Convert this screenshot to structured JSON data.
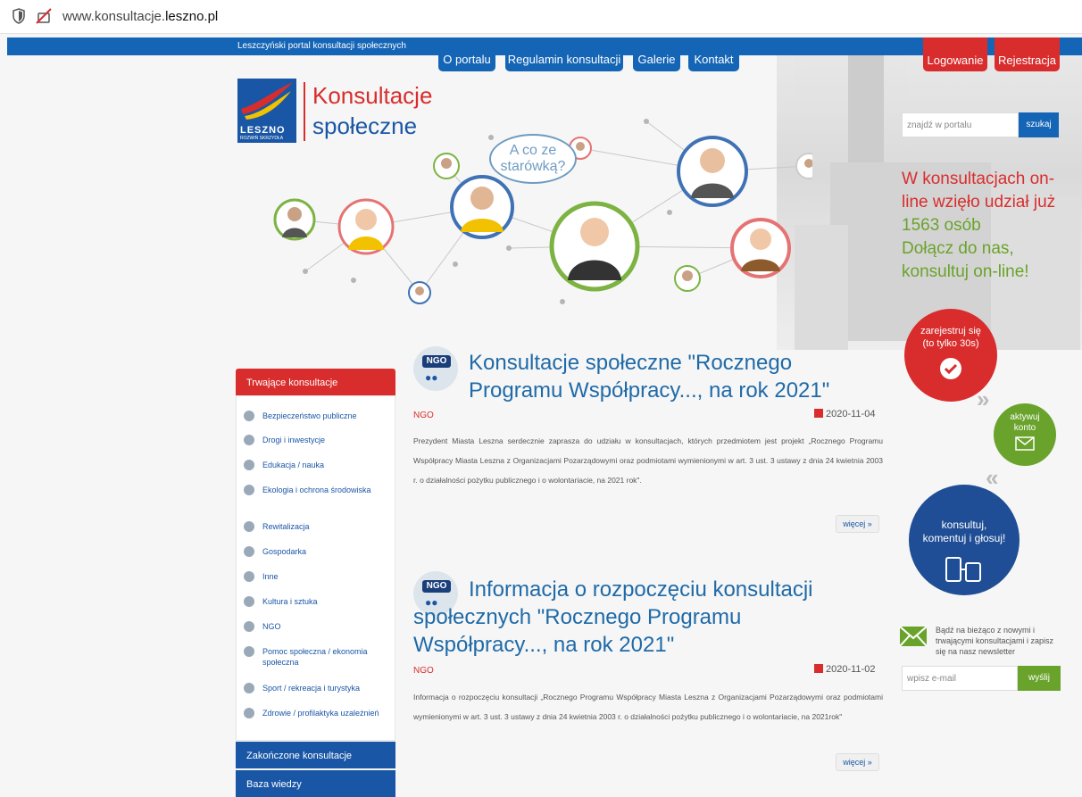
{
  "browser": {
    "url_prefix": "www.konsultacje.",
    "url_domain": "leszno.pl"
  },
  "header": {
    "tagline": "Leszczyński portal konsultacji społecznych",
    "nav": [
      "O portalu",
      "Regulamin konsultacji",
      "Galerie",
      "Kontakt"
    ],
    "login": "Logowanie",
    "register": "Rejestracja"
  },
  "logo": {
    "city": "LESZNO",
    "motto": "ROZWIŃ SKRZYDŁA",
    "brand_line1": "Konsultacje",
    "brand_line2": "społeczne"
  },
  "hero": {
    "bubble_line1": "A co ze",
    "bubble_line2": "starówką?"
  },
  "search": {
    "placeholder": "znajdź w portalu",
    "button": "szukaj"
  },
  "promo": {
    "line1": "W konsultacjach on-line wzięło udział już",
    "count": "1563 osób",
    "line2": "Dołącz do nas, konsultuj on-line!"
  },
  "steps": {
    "step1_line1": "zarejestruj się",
    "step1_line2": "(to tylko 30s)",
    "step2_line1": "aktywuj",
    "step2_line2": "konto",
    "step3_line1": "konsultuj,",
    "step3_line2": "komentuj i głosuj!"
  },
  "newsletter": {
    "text": "Bądź na bieżąco z nowymi i trwającymi konsultacjami i zapisz się na nasz newsletter",
    "placeholder": "wpisz e-mail",
    "button": "wyślij"
  },
  "sidebar": {
    "header": "Trwające konsultacje",
    "items": [
      "Bezpieczeństwo publiczne",
      "Drogi i inwestycje",
      "Edukacja / nauka",
      "Ekologia i ochrona środowiska",
      "Rewitalizacja",
      "Gospodarka",
      "Inne",
      "Kultura i sztuka",
      "NGO",
      "Pomoc społeczna / ekonomia społeczna",
      "Sport / rekreacja i turystyka",
      "Zdrowie / profilaktyka uzależnień"
    ],
    "footer1": "Zakończone konsultacje",
    "footer2": "Baza wiedzy"
  },
  "articles": [
    {
      "badge": "NGO",
      "title": "Konsultacje społeczne \"Rocznego Programu Współpracy..., na rok 2021\"",
      "category": "NGO",
      "date": "2020-11-04",
      "body": "Prezydent Miasta Leszna serdecznie zaprasza do udziału w konsultacjach, których przedmiotem jest projekt „Rocznego Programu Współpracy Miasta Leszna z Organizacjami Pozarządowymi oraz podmiotami wymienionymi w art. 3 ust. 3 ustawy z dnia 24 kwietnia 2003 r. o działalności pożytku publicznego i o wolontariacie, na 2021 rok\".",
      "more": "więcej »"
    },
    {
      "badge": "NGO",
      "title": "Informacja o rozpoczęciu konsultacji społecznych \"Rocznego Programu Współpracy..., na rok 2021\"",
      "category": "NGO",
      "date": "2020-11-02",
      "body": "Informacja o rozpoczęciu konsultacji „Rocznego Programu Współpracy Miasta Leszna z Organizacjami Pozarządowymi oraz podmiotami wymienionymi w art. 3 ust. 3 ustawy z dnia 24 kwietnia 2003 r. o działalności pożytku publicznego i o wolontariacie, na 2021rok\"",
      "more": "więcej »"
    }
  ],
  "colors": {
    "blue": "#1565b6",
    "red": "#d92d2d",
    "green": "#6aa32c",
    "navy": "#1f4e96"
  }
}
